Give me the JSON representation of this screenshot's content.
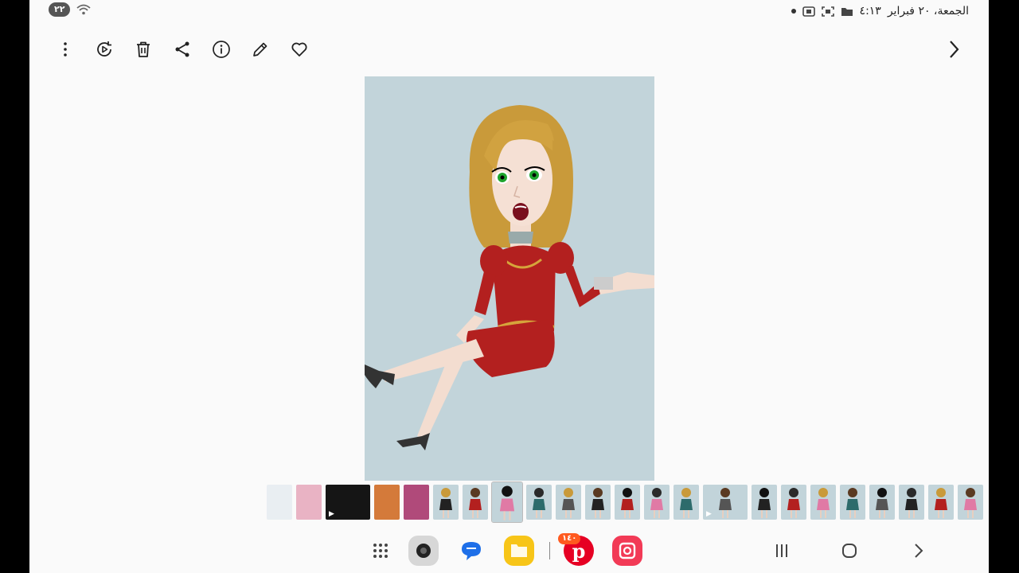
{
  "status_bar": {
    "date": "الجمعة، ٢٠ فبراير",
    "time": "٤:١٣",
    "battery": "٢٢",
    "icons": [
      "screen-record-icon",
      "screenshot-icon",
      "folder-icon",
      "notification-dot-icon",
      "wifi-icon"
    ]
  },
  "toolbar": {
    "items": [
      {
        "name": "more-options",
        "icon": "vertical-dots-icon"
      },
      {
        "name": "remaster",
        "icon": "play-rotate-icon"
      },
      {
        "name": "delete",
        "icon": "trash-icon"
      },
      {
        "name": "share",
        "icon": "share-icon"
      },
      {
        "name": "details",
        "icon": "info-icon"
      },
      {
        "name": "edit",
        "icon": "pencil-icon"
      },
      {
        "name": "favorite",
        "icon": "heart-icon"
      }
    ],
    "next_icon": "chevron-right-icon"
  },
  "main_image": {
    "subject": "cartoon woman in red dress",
    "background_color": "#c2d4da"
  },
  "filmstrip": {
    "thumbnails": [
      {
        "type": "screenshot",
        "color": "#e9eef2"
      },
      {
        "type": "pattern",
        "color": "#e9b3c4"
      },
      {
        "type": "video",
        "color": "#151515"
      },
      {
        "type": "photo",
        "color": "#d47a3a"
      },
      {
        "type": "pattern",
        "color": "#b04a7a"
      },
      {
        "type": "character",
        "color": "#c2d4da"
      },
      {
        "type": "character",
        "color": "#c2d4da"
      },
      {
        "type": "character-selected",
        "color": "#c2d4da"
      },
      {
        "type": "character",
        "color": "#c2d4da"
      },
      {
        "type": "character",
        "color": "#c2d4da"
      },
      {
        "type": "character",
        "color": "#c2d4da"
      },
      {
        "type": "character",
        "color": "#c2d4da"
      },
      {
        "type": "character",
        "color": "#c2d4da"
      },
      {
        "type": "character",
        "color": "#c2d4da"
      },
      {
        "type": "video",
        "color": "#c2d4da"
      },
      {
        "type": "character",
        "color": "#c2d4da"
      },
      {
        "type": "character",
        "color": "#c2d4da"
      },
      {
        "type": "character",
        "color": "#c2d4da"
      },
      {
        "type": "character",
        "color": "#c2d4da"
      },
      {
        "type": "character",
        "color": "#c2d4da"
      },
      {
        "type": "character",
        "color": "#c2d4da"
      },
      {
        "type": "character",
        "color": "#c2d4da"
      },
      {
        "type": "character",
        "color": "#c2d4da"
      }
    ]
  },
  "navbar": {
    "apps": [
      {
        "name": "app-drawer",
        "icon": "grid-icon"
      },
      {
        "name": "camera",
        "icon": "camera-icon",
        "color": "#d7d7d7"
      },
      {
        "name": "messages",
        "icon": "chat-icon",
        "color": "#1e6fe8"
      },
      {
        "name": "my-files",
        "icon": "folder-icon",
        "color": "#f7c518"
      },
      {
        "name": "pinterest",
        "icon": "pinterest-icon",
        "color": "#e60023",
        "badge": "١٤٠"
      },
      {
        "name": "screen-recorder",
        "icon": "record-icon",
        "color": "#f23a56"
      }
    ],
    "system": [
      {
        "name": "recents",
        "icon": "recents-icon"
      },
      {
        "name": "home",
        "icon": "home-icon"
      },
      {
        "name": "back",
        "icon": "back-chevron-icon"
      }
    ]
  }
}
